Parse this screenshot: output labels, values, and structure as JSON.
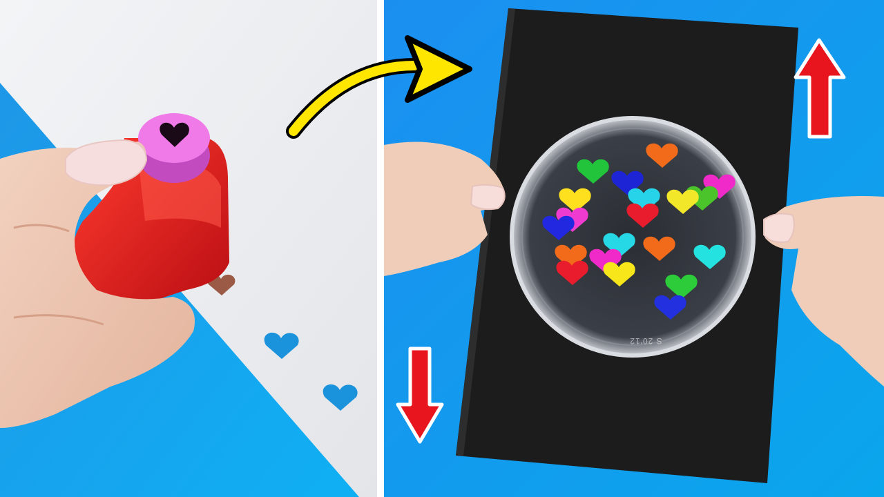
{
  "scene": {
    "left_panel": {
      "background_top_color": "#eef0f2",
      "blue_color": "#1aa0f0",
      "punch_body_color": "#e11c1c",
      "punch_button_color": "#e06ad6",
      "punched_hole_color": "#1d93df",
      "hearts_on_table": 3
    },
    "right_panel": {
      "background_color": "#1a8fee",
      "notebook_color": "#1b1b1b",
      "lid_marking": "S 20'12",
      "arrow_up_color": "#e8141e",
      "arrow_down_color": "#e8141e",
      "heart_colors": [
        "#22c23a",
        "#f06a14",
        "#1c22d4",
        "#f020c8",
        "#ffe21a",
        "#22c8e8",
        "#e81c2c",
        "#f6e61a",
        "#24e0e0",
        "#2230e0"
      ],
      "hearts_in_lid": 22
    },
    "connector_arrow_color": "#ffe600"
  }
}
